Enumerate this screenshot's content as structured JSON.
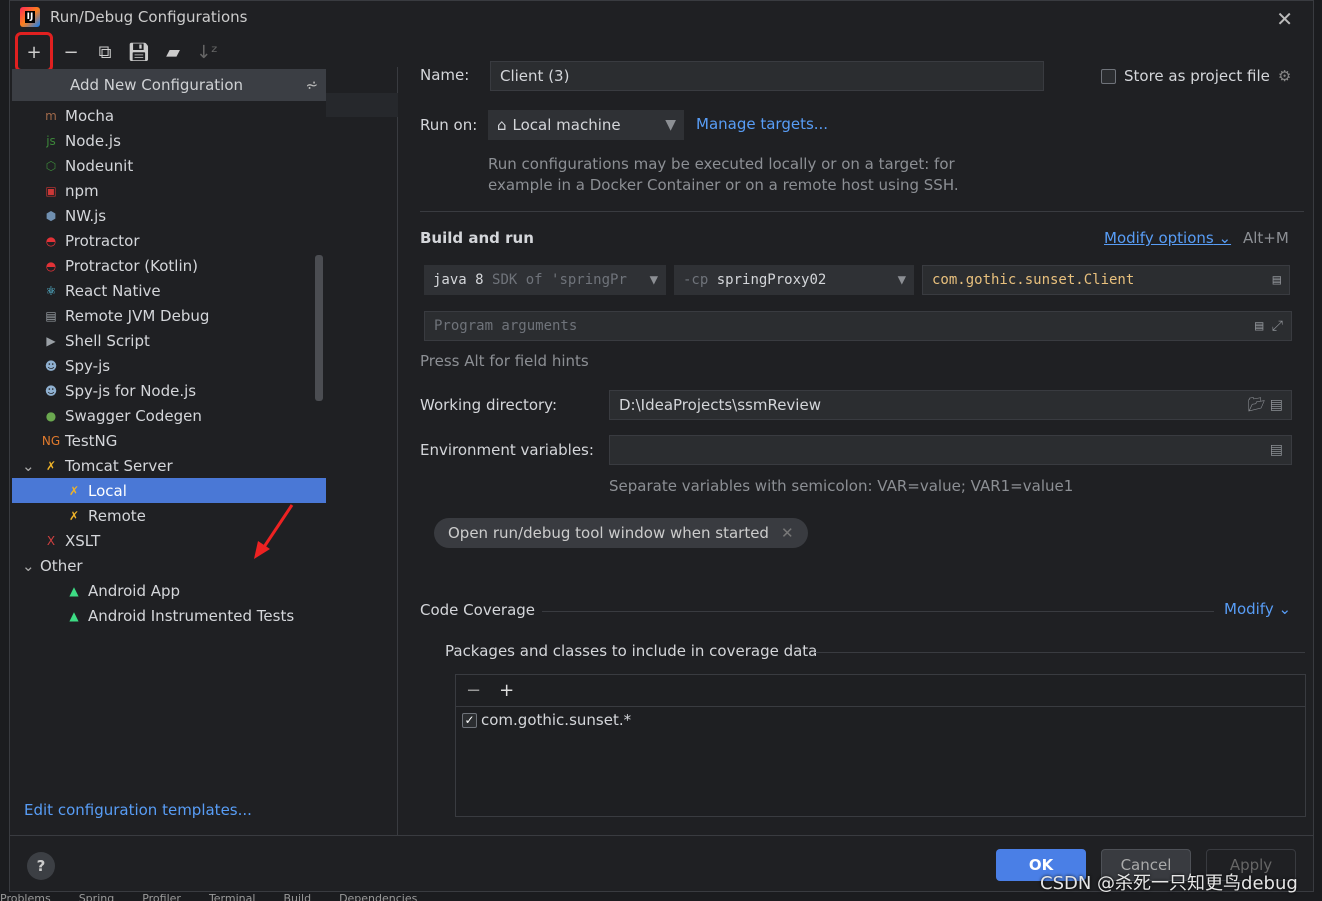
{
  "window": {
    "title": "Run/Debug Configurations"
  },
  "toolbar": [
    "add-icon",
    "remove-icon",
    "copy-icon",
    "save-icon",
    "new-folder-icon",
    "sort-icon"
  ],
  "left": {
    "add_new": "Add New Configuration",
    "items": [
      {
        "label": "Mocha",
        "icon": "mocha-icon",
        "color": "#a0694a",
        "glyph": "m",
        "indent": 1
      },
      {
        "label": "Node.js",
        "icon": "nodejs-icon",
        "color": "#3c873a",
        "glyph": "js",
        "indent": 1
      },
      {
        "label": "Nodeunit",
        "icon": "nodeunit-icon",
        "color": "#3c873a",
        "glyph": "⬡",
        "indent": 1
      },
      {
        "label": "npm",
        "icon": "npm-icon",
        "color": "#cb3837",
        "glyph": "▣",
        "indent": 1
      },
      {
        "label": "NW.js",
        "icon": "nwjs-icon",
        "color": "#6f8fb0",
        "glyph": "⬢",
        "indent": 1
      },
      {
        "label": "Protractor",
        "icon": "protractor-icon",
        "color": "#e23237",
        "glyph": "◓",
        "indent": 1
      },
      {
        "label": "Protractor (Kotlin)",
        "icon": "protractor-icon",
        "color": "#e23237",
        "glyph": "◓",
        "indent": 1
      },
      {
        "label": "React Native",
        "icon": "react-icon",
        "color": "#61dafb",
        "glyph": "⚛",
        "indent": 1
      },
      {
        "label": "Remote JVM Debug",
        "icon": "remote-debug-icon",
        "color": "#9aa0a6",
        "glyph": "▤",
        "indent": 1
      },
      {
        "label": "Shell Script",
        "icon": "shell-icon",
        "color": "#9aa0a6",
        "glyph": "▶",
        "indent": 1
      },
      {
        "label": "Spy-js",
        "icon": "spyjs-icon",
        "color": "#8fb0d0",
        "glyph": "☻",
        "indent": 1
      },
      {
        "label": "Spy-js for Node.js",
        "icon": "spyjs-node-icon",
        "color": "#8fb0d0",
        "glyph": "☻",
        "indent": 1
      },
      {
        "label": "Swagger Codegen",
        "icon": "swagger-icon",
        "color": "#6aa84f",
        "glyph": "●",
        "indent": 1
      },
      {
        "label": "TestNG",
        "icon": "testng-icon",
        "color": "#e07a2d",
        "glyph": "NG",
        "indent": 1
      },
      {
        "label": "Tomcat Server",
        "icon": "tomcat-icon",
        "color": "#f0b429",
        "glyph": "✗",
        "indent": 1,
        "expanded": true
      },
      {
        "label": "Local",
        "icon": "tomcat-icon",
        "color": "#f0b429",
        "glyph": "✗",
        "indent": 2,
        "selected": true
      },
      {
        "label": "Remote",
        "icon": "tomcat-icon",
        "color": "#f0b429",
        "glyph": "✗",
        "indent": 2
      },
      {
        "label": "XSLT",
        "icon": "xslt-icon",
        "color": "#d04040",
        "glyph": "X",
        "indent": 1
      },
      {
        "label": "Other",
        "icon": "",
        "indent": 0,
        "expanded": true
      },
      {
        "label": "Android App",
        "icon": "android-icon",
        "color": "#3ddc84",
        "glyph": "▲",
        "indent": 2
      },
      {
        "label": "Android Instrumented Tests",
        "icon": "android-icon",
        "color": "#3ddc84",
        "glyph": "▲",
        "indent": 2
      }
    ],
    "edit_templates": "Edit configuration templates..."
  },
  "form": {
    "name_label": "Name:",
    "name_value": "Client (3)",
    "store_label": "Store as project file",
    "store_checked": false,
    "run_on_label": "Run on:",
    "run_on_value": "Local machine",
    "manage_targets": "Manage targets...",
    "run_on_hint1": "Run configurations may be executed locally or on a target: for",
    "run_on_hint2": "example in a Docker Container or on a remote host using SSH.",
    "build_run": "Build and run",
    "modify_options": "Modify options",
    "modify_shortcut": "Alt+M",
    "jdk_main": "java 8",
    "jdk_dim": "SDK of 'springPr",
    "cp_dim": "-cp",
    "cp_value": "springProxy02",
    "main_class": "com.gothic.sunset.Client",
    "program_args_placeholder": "Program arguments",
    "alt_hint": "Press Alt for field hints",
    "workdir_label": "Working directory:",
    "workdir_value": "D:\\IdeaProjects\\ssmReview",
    "env_label": "Environment variables:",
    "env_value": "",
    "env_hint": "Separate variables with semicolon: VAR=value; VAR1=value1",
    "chip": "Open run/debug tool window when started",
    "coverage": "Code Coverage",
    "modify": "Modify",
    "packages_label": "Packages and classes to include in coverage data",
    "coverage_items": [
      {
        "label": "com.gothic.sunset.*",
        "checked": true
      }
    ]
  },
  "buttons": {
    "ok": "OK",
    "cancel": "Cancel",
    "apply": "Apply",
    "help": "?"
  },
  "watermark": "CSDN @杀死一只知更鸟debug",
  "statusbar": [
    "Problems",
    "Spring",
    "Profiler",
    "Terminal",
    "Build",
    "Dependencies"
  ],
  "colors": {
    "accent": "#4a78d6",
    "link": "#589df6",
    "highlight_box": "#e02020",
    "main_class": "#e8c07d"
  }
}
